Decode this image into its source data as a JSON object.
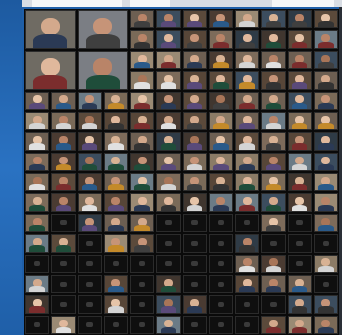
{
  "meeting": {
    "layout": "gallery-view",
    "accent_color": "#1f5fa8",
    "tile_background": "#151515"
  }
}
